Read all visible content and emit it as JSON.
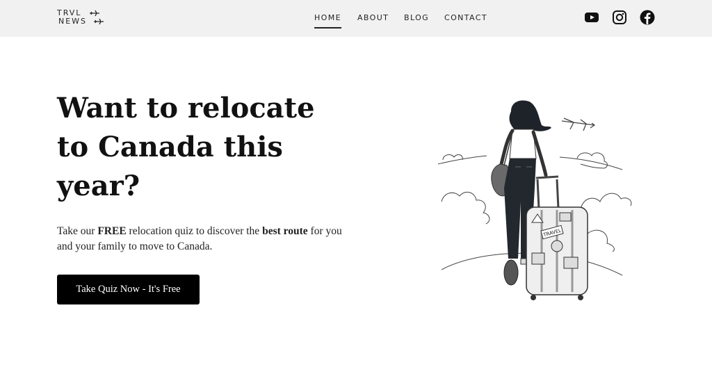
{
  "brand": {
    "line1": "TRVL",
    "line2": "NEWS"
  },
  "nav": {
    "items": [
      {
        "label": "HOME",
        "active": true
      },
      {
        "label": "ABOUT",
        "active": false
      },
      {
        "label": "BLOG",
        "active": false
      },
      {
        "label": "CONTACT",
        "active": false
      }
    ]
  },
  "social": [
    "youtube-icon",
    "instagram-icon",
    "facebook-icon"
  ],
  "hero": {
    "title": "Want to relocate to Canada this year?",
    "text_1": "Take our ",
    "text_bold_1": "FREE",
    "text_2": " relocation quiz to discover the ",
    "text_bold_2": "best route",
    "text_3": " for you and your family to move to Canada.",
    "cta_label": "Take Quiz Now - It's Free"
  },
  "luggage_sticker": "TRAVEL",
  "colors": {
    "topbar_bg": "#f1f1f1",
    "button_bg": "#000000",
    "button_text": "#ffffff"
  }
}
